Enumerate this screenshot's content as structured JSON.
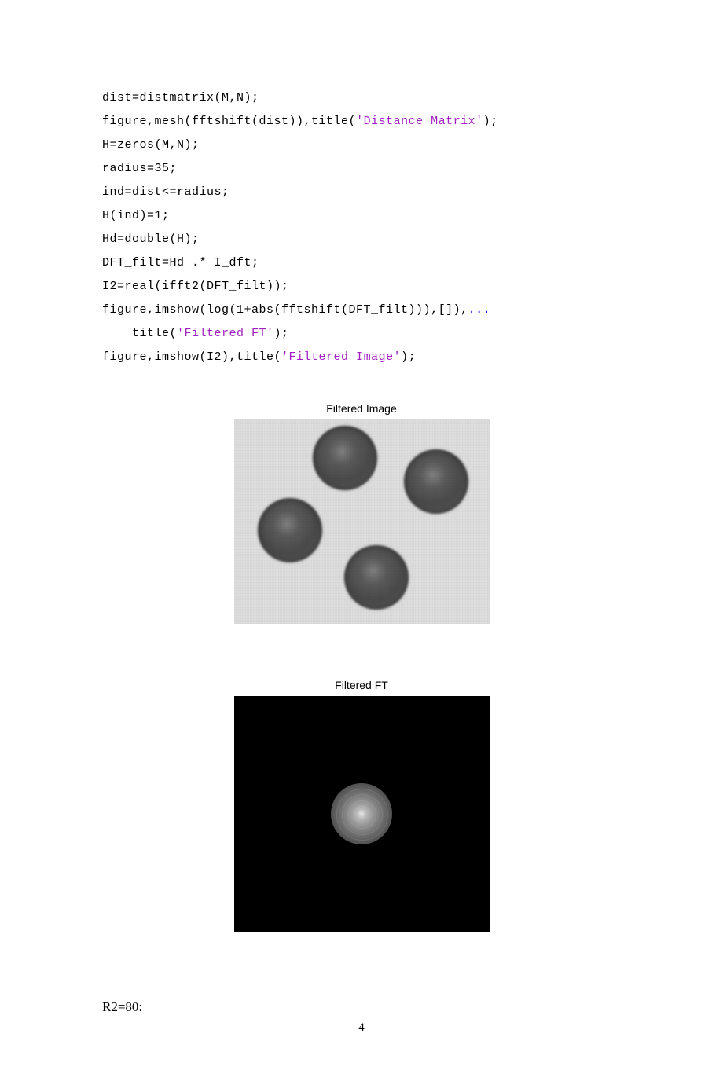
{
  "code": {
    "l1_a": "dist=distmatrix(M,N);",
    "l2_a": "figure,mesh(fftshift(dist)),title(",
    "l2_str": "'Distance Matrix'",
    "l2_b": ");",
    "l3_a": "H=zeros(M,N);",
    "l4_a": "radius=35;",
    "l5_a": "ind=dist<=radius;",
    "l6_a": "H(ind)=1;",
    "l7_a": "Hd=double(H);",
    "l8_a": "DFT_filt=Hd .* I_dft;",
    "l9_a": "I2=real(ifft2(DFT_filt));",
    "l10_a": "figure,imshow(log(1+abs(fftshift(DFT_filt))),[]),",
    "l10_cont": "...",
    "l11_a": "    title(",
    "l11_str": "'Filtered FT'",
    "l11_b": ");",
    "l12_a": "figure,imshow(I2),title(",
    "l12_str": "'Filtered Image'",
    "l12_b": ");"
  },
  "fig1": {
    "title": "Filtered Image"
  },
  "fig2": {
    "title": "Filtered FT"
  },
  "bottom": "R2=80:",
  "page_number": "4"
}
